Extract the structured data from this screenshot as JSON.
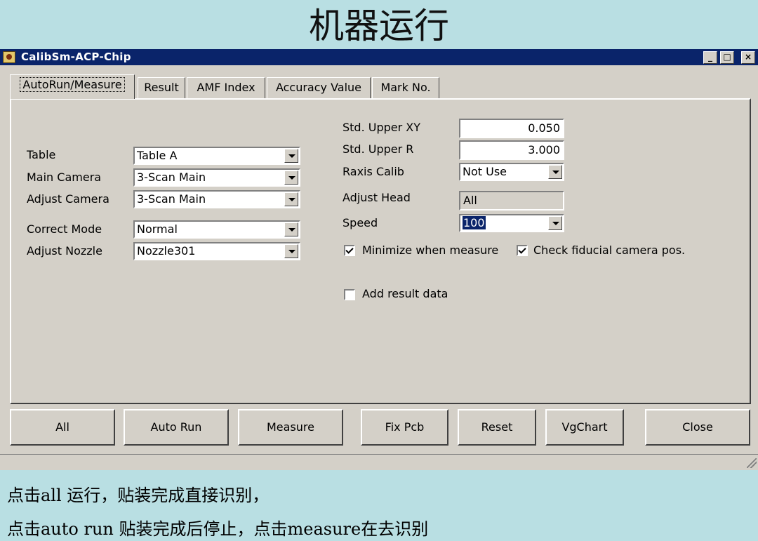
{
  "slide": {
    "title": "机器运行",
    "notes": [
      "点击all 运行，贴装完成直接识别，",
      "点击auto run 贴装完成后停止，点击measure在去识别"
    ]
  },
  "window": {
    "title": "CalibSm-ACP-Chip",
    "controls": [
      "_",
      "□",
      "×"
    ]
  },
  "tabs": [
    "AutoRun/Measure",
    "Result",
    "AMF Index",
    "Accuracy Value",
    "Mark No."
  ],
  "left": {
    "table_label": "Table",
    "table_value": "Table A",
    "main_camera_label": "Main Camera",
    "main_camera_value": "3-Scan Main",
    "adjust_camera_label": "Adjust Camera",
    "adjust_camera_value": "3-Scan Main",
    "correct_mode_label": "Correct Mode",
    "correct_mode_value": "Normal",
    "adjust_nozzle_label": "Adjust Nozzle",
    "adjust_nozzle_value": "Nozzle301"
  },
  "right": {
    "std_upper_xy_label": "Std. Upper XY",
    "std_upper_xy_value": "0.050",
    "std_upper_r_label": "Std. Upper R",
    "std_upper_r_value": "3.000",
    "raxis_calib_label": "Raxis Calib",
    "raxis_calib_value": "Not Use",
    "adjust_head_label": "Adjust Head",
    "adjust_head_value": "All",
    "speed_label": "Speed",
    "speed_value": "100",
    "minimize_label": "Minimize when measure",
    "minimize_checked": true,
    "check_fiducial_label": "Check fiducial camera pos.",
    "check_fiducial_checked": true,
    "add_result_label": "Add result data",
    "add_result_checked": false
  },
  "buttons": {
    "all": "All",
    "auto_run": "Auto Run",
    "measure": "Measure",
    "fix_pcb": "Fix Pcb",
    "reset": "Reset",
    "vgchart": "VgChart",
    "close": "Close"
  }
}
